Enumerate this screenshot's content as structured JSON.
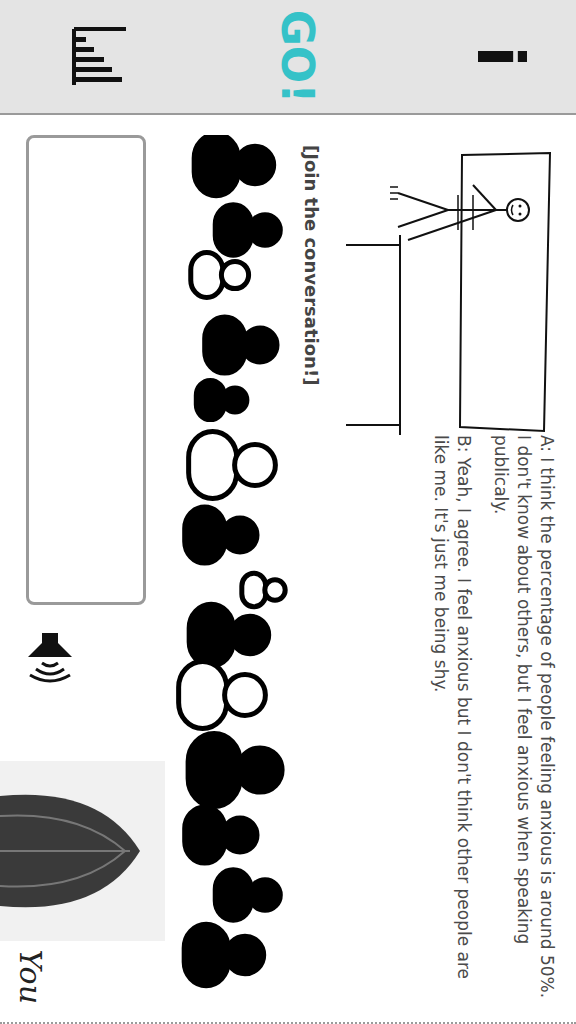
{
  "sidebar": {
    "info": "i",
    "go": "GO!"
  },
  "dialogue": [
    {
      "speaker": "A:",
      "text": "I think the percentage of people feeling anxious is around 50%. I don't know about others, but I feel anxious when speaking publicaly."
    },
    {
      "speaker": "B:",
      "text": "Yeah, I agree. I feel anxious but I don't think other people are like me. It's just me being shy."
    }
  ],
  "prompt": "[Join the conversation!]",
  "input": {
    "value": ""
  },
  "user_label": "You"
}
